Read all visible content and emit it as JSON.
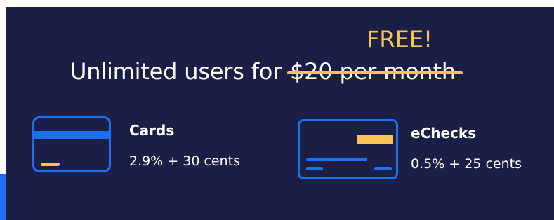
{
  "offer": {
    "headline_prefix": "Unlimited users for",
    "old_price": "$20 per month",
    "new_price_label": "FREE!"
  },
  "pricing": {
    "cards": {
      "title": "Cards",
      "rate": "2.9% + 30 cents"
    },
    "echecks": {
      "title": "eChecks",
      "rate": "0.5% + 25 cents"
    }
  },
  "colors": {
    "panel_background": "#1b1f45",
    "accent_blue": "#1e6ff2",
    "highlight_yellow": "#f6c453",
    "text_white": "#ffffff"
  },
  "icons": {
    "cards": "credit-card-icon",
    "echecks": "check-icon"
  }
}
